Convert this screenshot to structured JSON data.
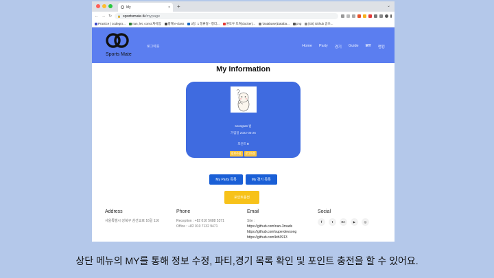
{
  "browser": {
    "tab_title": "My",
    "tab_close": "×",
    "new_tab": "+",
    "tab_chevron": "⌄",
    "url_host": "sportsmate.tk",
    "url_path": "/mypage",
    "back": "←",
    "forward": "→",
    "reload": "↻",
    "lock": "🔒",
    "traffic_lights": [
      "#ff5f57",
      "#febc2e",
      "#28c840"
    ],
    "bookmarks": [
      {
        "label": "Practice | codegro...",
        "color": "#3c4ac8"
      },
      {
        "label": "nan, let, const 차이점",
        "color": "#2e7d32"
      },
      {
        "label": "항해 e-class",
        "color": "#444"
      },
      {
        "label": "3강. 1 정류형 - 정리...",
        "color": "#1565c0"
      },
      {
        "label": "원도우 도커(docker)...",
        "color": "#e53935"
      },
      {
        "label": "'Database(Databa...",
        "color": "#777"
      },
      {
        "label": "png",
        "color": "#555"
      },
      {
        "label": "[Git] Github 글쓰...",
        "color": "#888"
      }
    ]
  },
  "site": {
    "logo_text": "Sports Mate",
    "login_link": "로그아웃",
    "nav": [
      {
        "label": "Home",
        "active": false
      },
      {
        "label": "Party",
        "active": false
      },
      {
        "label": "경기",
        "active": false
      },
      {
        "label": "Guide",
        "active": false
      },
      {
        "label": "MY",
        "active": true
      },
      {
        "label": "랭킹",
        "active": false
      }
    ],
    "brand_color": "#5b7ef0"
  },
  "mypage": {
    "title": "My Information",
    "nickname": "seongran 님",
    "joined": "가입일 2022-05-26",
    "points_label": "포인트",
    "points_value": "0",
    "edit_button": "정보수정",
    "logout_button": "로그아웃",
    "my_party_button": "My Party 목록",
    "my_game_button": "My 경기 목록",
    "charge_button": "포인트충전"
  },
  "footer": {
    "address_heading": "Address",
    "address_text": "서울특별시 성북구 삼선교로 16길 116",
    "phone_heading": "Phone",
    "reception": "Reception : +82 010 5688 5371",
    "office": "Office : +82 010 7132 9471",
    "email_heading": "Email",
    "site_label": "Site :",
    "links": [
      "https://github.com/nan-3roads",
      "https://github.com/superdevsong",
      "https://github.com/kth3913"
    ],
    "social_heading": "Social",
    "social_icons": [
      "f",
      "t",
      "G+",
      "▶",
      "◎"
    ]
  },
  "caption": "상단 메뉴의 MY를 통해 정보 수정, 파티,경기 목록 확인 및 포인트 충전을 할 수 있어요."
}
